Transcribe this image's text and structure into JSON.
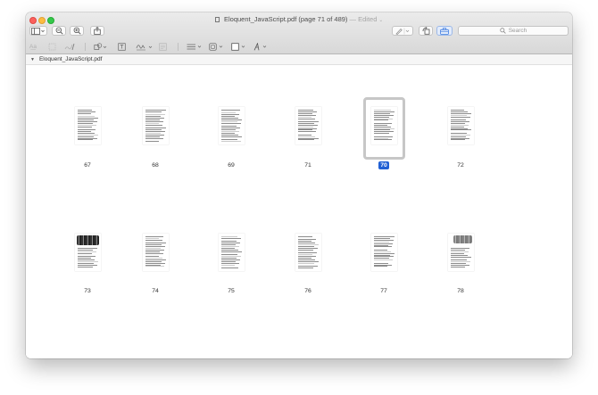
{
  "window": {
    "title": "Eloquent_JavaScript.pdf (page 71 of 489)",
    "edited": "— Edited",
    "title_chevron": "⌄"
  },
  "toolbar": {
    "search_placeholder": "Search",
    "accent": "#2160d4"
  },
  "markup_bar": {
    "text_tool_label": "A͟a"
  },
  "sidebar": {
    "file_name": "Eloquent_JavaScript.pdf",
    "disclosure": "▼"
  },
  "thumbnails": [
    {
      "label": "67",
      "selected": false
    },
    {
      "label": "68",
      "selected": false
    },
    {
      "label": "69",
      "selected": false
    },
    {
      "label": "71",
      "selected": false
    },
    {
      "label": "70",
      "selected": true
    },
    {
      "label": "72",
      "selected": false
    },
    {
      "label": "73",
      "selected": false
    },
    {
      "label": "74",
      "selected": false
    },
    {
      "label": "75",
      "selected": false
    },
    {
      "label": "76",
      "selected": false
    },
    {
      "label": "77",
      "selected": false
    },
    {
      "label": "78",
      "selected": false
    }
  ]
}
